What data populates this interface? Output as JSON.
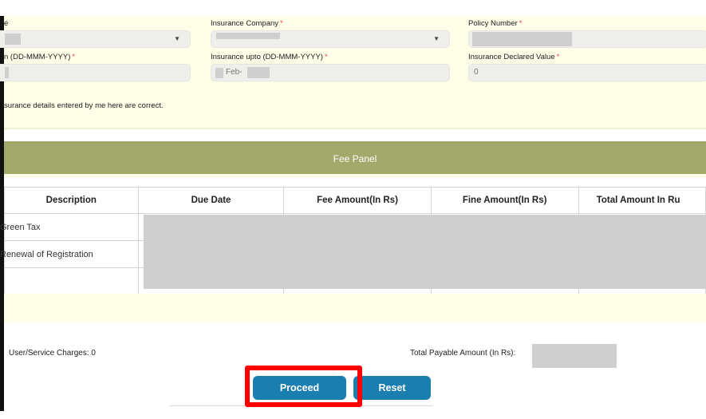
{
  "form": {
    "col1_label_top": "e",
    "col1_label_bottom": "n (DD-MMM-YYYY)",
    "insurance_company_label": "Insurance Company",
    "policy_number_label": "Policy Number",
    "insurance_upto_label": "Insurance upto (DD-MMM-YYYY)",
    "insurance_upto_value": "Feb-",
    "declared_value_label": "Insurance Declared Value",
    "declared_value": "0",
    "required_mark": "*",
    "declaration": "surance details entered by me here are correct."
  },
  "fee_panel": {
    "title": "Fee Panel",
    "headers": [
      "Description",
      "Due Date",
      "Fee Amount(In Rs)",
      "Fine Amount(In Rs)",
      "Total Amount In Ru"
    ],
    "rows": [
      "Green Tax",
      "Renewal of Registration"
    ]
  },
  "footer": {
    "user_charges": "User/Service Charges: 0",
    "total_payable_label": "Total Payable Amount (In Rs):"
  },
  "buttons": {
    "proceed": "Proceed",
    "reset": "Reset"
  },
  "colors": {
    "panel": "#a3a96a",
    "button": "#1a7fb0",
    "highlight": "#ff0000",
    "form_bg": "#fdfde8"
  }
}
